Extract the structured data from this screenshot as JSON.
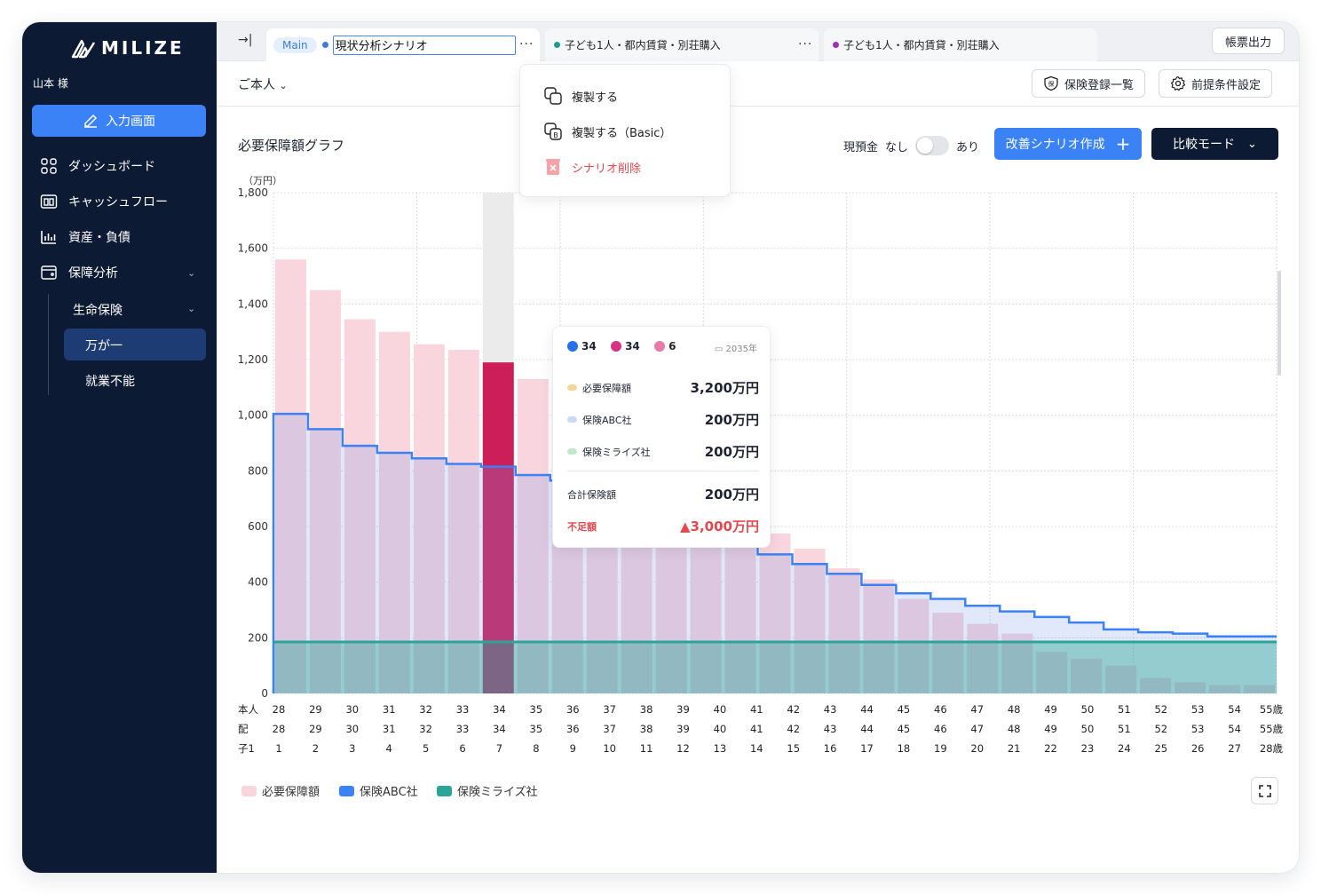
{
  "app": {
    "brand": "MILIZE"
  },
  "sidebar": {
    "username": "山本 様",
    "input_button": "入力画面",
    "items": [
      {
        "label": "ダッシュボード",
        "icon": "grid-icon"
      },
      {
        "label": "キャッシュフロー",
        "icon": "cashflow-icon"
      },
      {
        "label": "資産・負債",
        "icon": "bar-chart-icon"
      },
      {
        "label": "保障分析",
        "icon": "wallet-icon"
      }
    ],
    "sub_group": "生命保険",
    "sub_items": [
      "万が一",
      "就業不能"
    ]
  },
  "tabs": [
    {
      "badge": "Main",
      "label": "現状分析シナリオ",
      "color": "#3b7ddd"
    },
    {
      "label": "子ども1人・都内賃貸・別荘購入",
      "color": "#1f9e8f"
    },
    {
      "label": "子ども1人・都内賃貸・別荘購入",
      "color": "#9b2fb5"
    }
  ],
  "tab_more": "···",
  "print_button": "帳票出力",
  "person_select": "ご本人",
  "header_buttons": {
    "insurance_list": "保険登録一覧",
    "conditions": "前提条件設定"
  },
  "dropdown": {
    "duplicate": "複製する",
    "duplicate_basic": "複製する（Basic）",
    "delete": "シナリオ削除"
  },
  "chart_section": {
    "title": "必要保障額グラフ",
    "cash_label": "現預金",
    "toggle_off": "なし",
    "toggle_on": "あり",
    "improve_button": "改善シナリオ作成",
    "compare_button": "比較モード"
  },
  "tooltip": {
    "ages": [
      "34",
      "34",
      "6"
    ],
    "year": "2035年",
    "rows": [
      {
        "label": "必要保障額",
        "value": "3,200万円",
        "color": "#f6d59a"
      },
      {
        "label": "保険ABC社",
        "value": "200万円",
        "color": "#c9daf8"
      },
      {
        "label": "保険ミライズ社",
        "value": "200万円",
        "color": "#c3e6cf"
      }
    ],
    "total_label": "合計保険額",
    "total_value": "200万円",
    "shortfall_label": "不足額",
    "shortfall_value": "▲3,000万円"
  },
  "colors": {
    "required": "#f9d5de",
    "abc": "#3b82f6",
    "mirai": "#2aa597",
    "highlight": "#cc1f5a",
    "sidebar": "#0c1a33"
  },
  "chart_data": {
    "type": "bar",
    "unit": "（万円）",
    "ylim": [
      0,
      1800
    ],
    "yticks": [
      0,
      200,
      400,
      600,
      800,
      1000,
      1200,
      1400,
      1600,
      1800
    ],
    "row_labels": [
      "本人",
      "配",
      "子1"
    ],
    "honin_ages": [
      "28",
      "29",
      "30",
      "31",
      "32",
      "33",
      "34",
      "35",
      "36",
      "37",
      "38",
      "39",
      "40",
      "41",
      "42",
      "43",
      "44",
      "45",
      "46",
      "47",
      "48",
      "49",
      "50",
      "51",
      "52",
      "53",
      "54",
      "55歳"
    ],
    "spouse_ages": [
      "28",
      "29",
      "30",
      "31",
      "32",
      "33",
      "34",
      "35",
      "36",
      "37",
      "38",
      "39",
      "40",
      "41",
      "42",
      "43",
      "44",
      "45",
      "46",
      "47",
      "48",
      "49",
      "50",
      "51",
      "52",
      "53",
      "54",
      "55歳"
    ],
    "child_ages": [
      "1",
      "2",
      "3",
      "4",
      "5",
      "6",
      "7",
      "8",
      "9",
      "10",
      "11",
      "12",
      "13",
      "14",
      "15",
      "16",
      "17",
      "18",
      "19",
      "20",
      "21",
      "22",
      "23",
      "24",
      "25",
      "26",
      "27",
      "28歳"
    ],
    "highlight_index": 6,
    "series": [
      {
        "name": "必要保障額",
        "values": [
          1560,
          1450,
          1345,
          1300,
          1255,
          1235,
          1190,
          1130,
          1095,
          1030,
          1000,
          960,
          910,
          860,
          575,
          520,
          450,
          410,
          340,
          290,
          250,
          215,
          150,
          125,
          100,
          55,
          40,
          30,
          30
        ]
      },
      {
        "name": "保険ABC社",
        "values": [
          1005,
          950,
          890,
          865,
          845,
          825,
          815,
          785,
          765,
          745,
          725,
          705,
          685,
          665,
          500,
          465,
          430,
          390,
          360,
          340,
          315,
          295,
          275,
          255,
          230,
          220,
          215,
          205,
          205
        ]
      },
      {
        "name": "保険ミライズ社",
        "values": [
          185,
          185,
          185,
          185,
          185,
          185,
          185,
          185,
          185,
          185,
          185,
          185,
          185,
          185,
          185,
          185,
          185,
          185,
          185,
          185,
          185,
          185,
          185,
          185,
          185,
          185,
          185,
          185,
          185
        ]
      }
    ]
  }
}
